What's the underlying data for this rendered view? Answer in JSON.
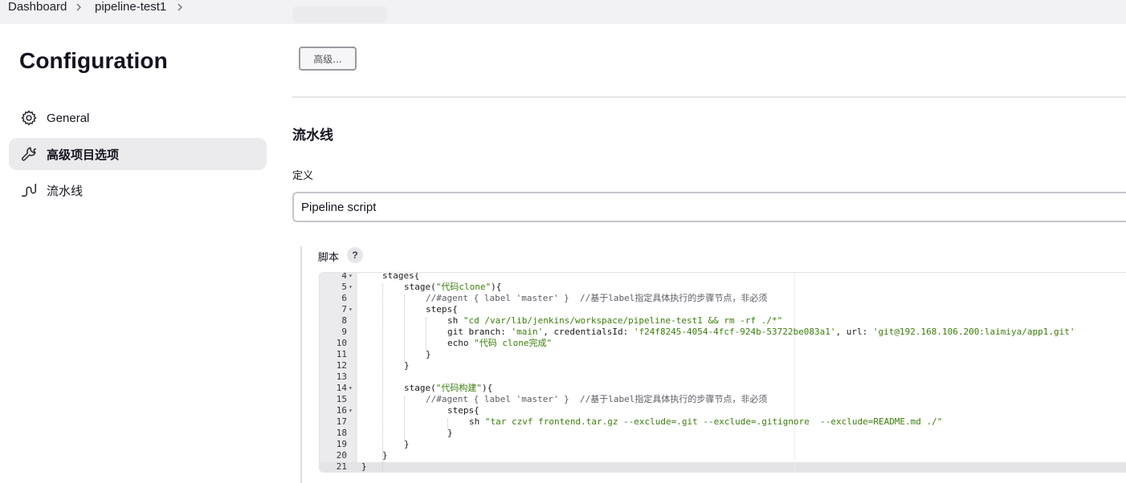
{
  "breadcrumb": {
    "items": [
      "Dashboard",
      "pipeline-test1"
    ]
  },
  "sidebar": {
    "title": "Configuration",
    "items": [
      {
        "label": "General",
        "icon": "gear-icon"
      },
      {
        "label": "高级项目选项",
        "icon": "wrench-icon",
        "active": true
      },
      {
        "label": "流水线",
        "icon": "pipeline-icon"
      }
    ]
  },
  "main": {
    "advanced_button": "高级...",
    "section_title": "流水线",
    "definition_label": "定义",
    "definition_value": "Pipeline script",
    "script_label": "脚本",
    "help_label": "?"
  },
  "editor": {
    "lines": [
      {
        "n": "4",
        "fold": true,
        "indent": 1,
        "parts": [
          [
            "t",
            "stages{"
          ]
        ]
      },
      {
        "n": "5",
        "fold": true,
        "indent": 2,
        "parts": [
          [
            "t",
            "stage("
          ],
          [
            "s",
            "\"代码clone\""
          ],
          [
            "t",
            "){"
          ]
        ]
      },
      {
        "n": "6",
        "fold": false,
        "indent": 3,
        "parts": [
          [
            "c",
            "//#agent { label 'master' }  //基于label指定具体执行的步骤节点，非必须"
          ]
        ]
      },
      {
        "n": "7",
        "fold": true,
        "indent": 3,
        "parts": [
          [
            "t",
            "steps{"
          ]
        ]
      },
      {
        "n": "8",
        "fold": false,
        "indent": 4,
        "parts": [
          [
            "t",
            "sh "
          ],
          [
            "s",
            "\"cd /var/lib/jenkins/workspace/pipeline-test1 && rm -rf ./*\""
          ]
        ]
      },
      {
        "n": "9",
        "fold": false,
        "indent": 4,
        "parts": [
          [
            "t",
            "git branch: "
          ],
          [
            "s",
            "'main'"
          ],
          [
            "t",
            ", credentialsId: "
          ],
          [
            "s",
            "'f24f8245-4054-4fcf-924b-53722be083a1'"
          ],
          [
            "t",
            ", url: "
          ],
          [
            "s",
            "'git@192.168.106.200:laimiya/app1.git'"
          ]
        ]
      },
      {
        "n": "10",
        "fold": false,
        "indent": 4,
        "parts": [
          [
            "t",
            "echo "
          ],
          [
            "s",
            "\"代码 clone完成\""
          ]
        ]
      },
      {
        "n": "11",
        "fold": false,
        "indent": 3,
        "parts": [
          [
            "t",
            "}"
          ]
        ]
      },
      {
        "n": "12",
        "fold": false,
        "indent": 2,
        "parts": [
          [
            "t",
            "}"
          ]
        ]
      },
      {
        "n": "13",
        "fold": false,
        "indent": 0,
        "parts": []
      },
      {
        "n": "14",
        "fold": true,
        "indent": 2,
        "parts": [
          [
            "t",
            "stage("
          ],
          [
            "s",
            "\"代码构建\""
          ],
          [
            "t",
            "){"
          ]
        ]
      },
      {
        "n": "15",
        "fold": false,
        "indent": 3,
        "parts": [
          [
            "c",
            "//#agent { label 'master' }  //基于label指定具体执行的步骤节点，非必须"
          ]
        ]
      },
      {
        "n": "16",
        "fold": true,
        "indent": 4,
        "parts": [
          [
            "t",
            "steps{"
          ]
        ]
      },
      {
        "n": "17",
        "fold": false,
        "indent": 5,
        "parts": [
          [
            "t",
            "sh "
          ],
          [
            "s",
            "\"tar czvf frontend.tar.gz --exclude=.git --exclude=.gitignore  --exclude=README.md ./\""
          ]
        ]
      },
      {
        "n": "18",
        "fold": false,
        "indent": 4,
        "parts": [
          [
            "t",
            "}"
          ]
        ]
      },
      {
        "n": "19",
        "fold": false,
        "indent": 2,
        "parts": [
          [
            "t",
            "}"
          ]
        ]
      },
      {
        "n": "20",
        "fold": false,
        "indent": 1,
        "parts": [
          [
            "t",
            "}"
          ]
        ]
      },
      {
        "n": "21",
        "fold": false,
        "indent": 0,
        "parts": [
          [
            "t",
            "}"
          ]
        ]
      }
    ]
  },
  "colors": {
    "string": "#3b7d0c",
    "comment": "#5c5c66",
    "active_nav": "#ebebee",
    "topbar": "#f2f2f4"
  }
}
